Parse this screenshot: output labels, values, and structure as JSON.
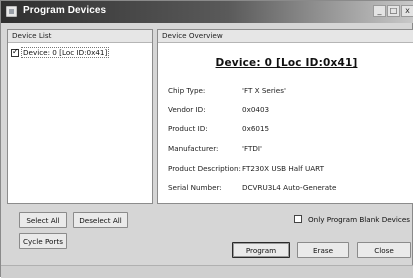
{
  "window": {
    "title": "Program Devices",
    "minimize_glyph": "_",
    "maximize_glyph": "□",
    "close_glyph": "x"
  },
  "device_list": {
    "header": "Device List",
    "items": [
      {
        "label": "Device: 0 [Loc ID:0x41]",
        "checked": true
      }
    ]
  },
  "overview": {
    "header": "Device Overview",
    "title": "Device: 0 [Loc ID:0x41]",
    "rows": [
      {
        "label": "Chip Type:",
        "value": "'FT X Series'"
      },
      {
        "label": "Vendor ID:",
        "value": "0x0403"
      },
      {
        "label": "Product ID:",
        "value": "0x6015"
      },
      {
        "label": "Manufacturer:",
        "value": "'FTDI'"
      },
      {
        "label": "Product Description:",
        "value": "FT230X USB Half UART"
      },
      {
        "label": "Serial Number:",
        "value": "DCVRU3L4 Auto-Generate"
      }
    ]
  },
  "buttons": {
    "select_all": "Select All",
    "deselect_all": "Deselect All",
    "cycle_ports": "Cycle Ports",
    "program": "Program",
    "erase": "Erase",
    "close": "Close"
  },
  "options": {
    "only_blank_label": "Only Program Blank Devices",
    "only_blank_checked": false
  }
}
